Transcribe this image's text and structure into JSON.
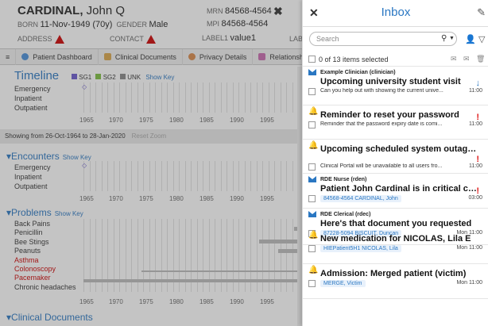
{
  "patient": {
    "surname": "CARDINAL",
    "forename": "John Q",
    "born_label": "BORN",
    "born": "11-Nov-1949 (70y)",
    "gender_label": "GENDER",
    "gender": "Male",
    "mrn_label": "MRN",
    "mrn": "84568-4564",
    "mpi_label": "MPI",
    "mpi": "84568-4564",
    "address_label": "ADDRESS",
    "contact_label": "CONTACT",
    "label1_label": "LABEL1",
    "label1": "value1",
    "lab_label": "LAB"
  },
  "tabs": [
    {
      "label": "Patient Dashboard"
    },
    {
      "label": "Clinical Documents"
    },
    {
      "label": "Privacy Details"
    },
    {
      "label": "Relationsh"
    }
  ],
  "timeline": {
    "title": "Timeline",
    "legend": [
      "SG1",
      "SG2",
      "UNK"
    ],
    "legend_colors": [
      "#6a5acd",
      "#7cbf3f",
      "#888888"
    ],
    "show_key": "Show Key",
    "rows": [
      "Emergency",
      "Inpatient",
      "Outpatient"
    ],
    "years": [
      "1965",
      "1970",
      "1975",
      "1980",
      "1985",
      "1990",
      "1995"
    ]
  },
  "range": {
    "text": "Showing from 26-Oct-1964 to 28-Jan-2020",
    "reset": "Reset Zoom"
  },
  "encounters": {
    "title": "Encounters",
    "show_key": "Show Key",
    "rows": [
      "Emergency",
      "Inpatient",
      "Outpatient"
    ],
    "years": [
      "1965",
      "1970",
      "1975",
      "1980",
      "1985",
      "1990",
      "1995"
    ]
  },
  "problems": {
    "title": "Problems",
    "show_key": "Show Key",
    "rows": [
      "Back Pains",
      "Penicillin",
      "Bee Stings",
      "Peanuts",
      "Asthma",
      "Colonoscopy",
      "Pacemaker",
      "Chronic headaches"
    ],
    "red_rows": [
      "Asthma",
      "Colonoscopy",
      "Pacemaker"
    ],
    "years": [
      "1965",
      "1970",
      "1975",
      "1980",
      "1985",
      "1990",
      "1995"
    ]
  },
  "clinical_docs": {
    "title": "Clinical Documents"
  },
  "inbox": {
    "title": "Inbox",
    "search_placeholder": "Search",
    "selection": "0 of 13 items selected",
    "messages": [
      {
        "sender": "Example Clinician (clinician)",
        "subject": "Upcoming university student visit",
        "preview": "Can you help out with showing the current unive...",
        "time": "11:00",
        "type": "mail",
        "flag": "down"
      },
      {
        "sender": "",
        "subject": "Reminder to reset your password",
        "preview": "Reminder that the password expiry date is comi...",
        "time": "11:00",
        "type": "bell",
        "flag": "!"
      },
      {
        "sender": "",
        "subject": "Upcoming scheduled system outage in 2 days",
        "preview": "Clinical Portal will be unavailable to all users fro...",
        "time": "11:00",
        "type": "bell",
        "flag": "!"
      },
      {
        "sender": "RDE Nurse (rden)",
        "subject": "Patient John Cardinal is in critical condi...",
        "tag": "84568-4564 CARDINAL, John",
        "time": "03:00",
        "type": "mail",
        "flag": "!"
      },
      {
        "sender": "RDE Clerical (rdec)",
        "subject": "Here's that document you requested",
        "tag": "87228-5094 BISCUIT, Duncan",
        "time": "Mon 11:00",
        "type": "mail",
        "flag": ""
      },
      {
        "sender": "",
        "subject": "New medication for NICOLAS, Lila E",
        "tag": "HIEPatient5H1 NICOLAS, Lila",
        "time": "Mon 11:00",
        "type": "bell",
        "flag": ""
      },
      {
        "sender": "",
        "subject": "Admission: Merged patient (victim)",
        "tag": "MERGE, Victim",
        "time": "Mon 11:00",
        "type": "bell",
        "flag": ""
      }
    ]
  }
}
